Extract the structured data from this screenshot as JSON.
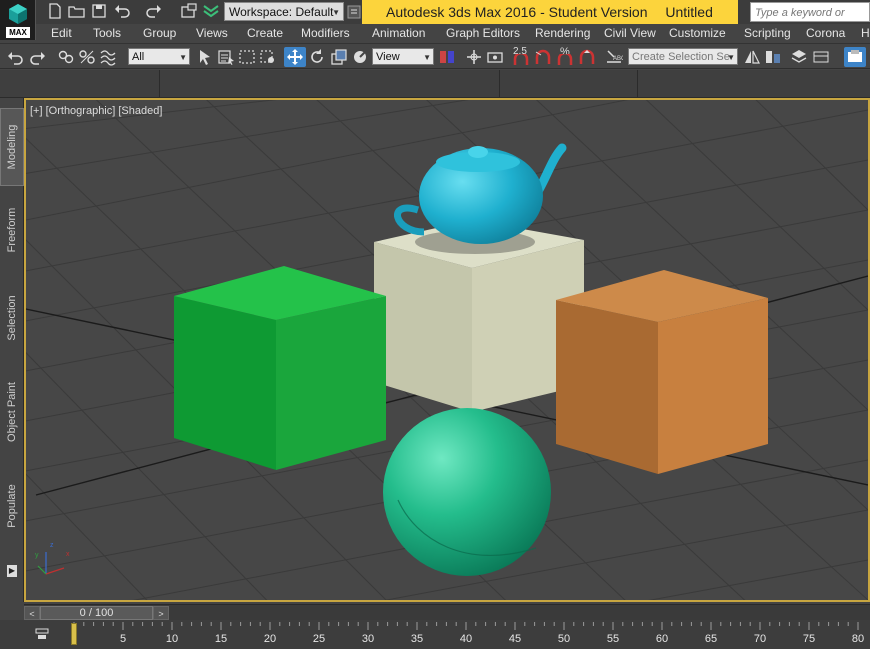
{
  "app": {
    "logo_label": "MAX",
    "title": "Autodesk 3ds Max 2016 - Student Version",
    "document": "Untitled",
    "workspace": "Workspace: Default",
    "search_placeholder": "Type a keyword or phrase",
    "accent_color": "#fcd43c"
  },
  "quick_access": [
    {
      "name": "new-file-icon"
    },
    {
      "name": "open-file-icon"
    },
    {
      "name": "save-icon"
    },
    {
      "name": "undo-icon"
    },
    {
      "name": "redo-icon"
    },
    {
      "name": "project-folder-icon"
    },
    {
      "name": "autodesk-a360-icon"
    }
  ],
  "menu": [
    "Edit",
    "Tools",
    "Group",
    "Views",
    "Create",
    "Modifiers",
    "Animation",
    "Graph Editors",
    "Rendering",
    "Civil View",
    "Customize",
    "Scripting",
    "Corona",
    "H"
  ],
  "toolbar": {
    "selection_filter": "All",
    "reference_coordinate": "View",
    "named_selection_placeholder": "Create Selection Se",
    "snap_label": "2.5",
    "percent_snap_label": "%",
    "icons": [
      "undo-icon",
      "redo-icon",
      "link-icon",
      "unlink-icon",
      "bind-space-warp-icon",
      "select-object-icon",
      "select-by-name-icon",
      "rectangular-selection-icon",
      "window-crossing-icon",
      "select-move-icon",
      "select-rotate-icon",
      "select-scale-icon",
      "placement-icon",
      "pivot-icon",
      "select-manipulate-icon",
      "keyboard-shortcut-icon",
      "snaps-toggle-icon",
      "angle-snap-icon",
      "percent-snap-icon",
      "spinner-snap-icon",
      "edit-named-selection-icon",
      "mirror-icon",
      "align-icon",
      "render-setup-icon"
    ]
  },
  "side_tabs": [
    "Modeling",
    "Freeform",
    "Selection",
    "Object Paint",
    "Populate"
  ],
  "viewport": {
    "label_plus": "[+]",
    "label_view": "[Orthographic]",
    "label_shading": "[Shaded]",
    "objects": [
      {
        "name": "teapot",
        "color": "#2fb4cf"
      },
      {
        "name": "box-white",
        "color": "#cfd0b5"
      },
      {
        "name": "box-green",
        "color": "#1fae3f"
      },
      {
        "name": "box-orange",
        "color": "#c8803f"
      },
      {
        "name": "sphere",
        "color": "#2cc08f"
      }
    ],
    "axis_labels": {
      "x": "x",
      "y": "y",
      "z": "z"
    }
  },
  "time_slider": {
    "frame_display": "0 / 100",
    "prev_label": "<",
    "next_label": ">"
  },
  "track_bar": {
    "ticks": [
      "5",
      "10",
      "15",
      "20",
      "25",
      "30",
      "35",
      "40",
      "45",
      "50",
      "55",
      "60",
      "65",
      "70",
      "75",
      "80"
    ]
  }
}
